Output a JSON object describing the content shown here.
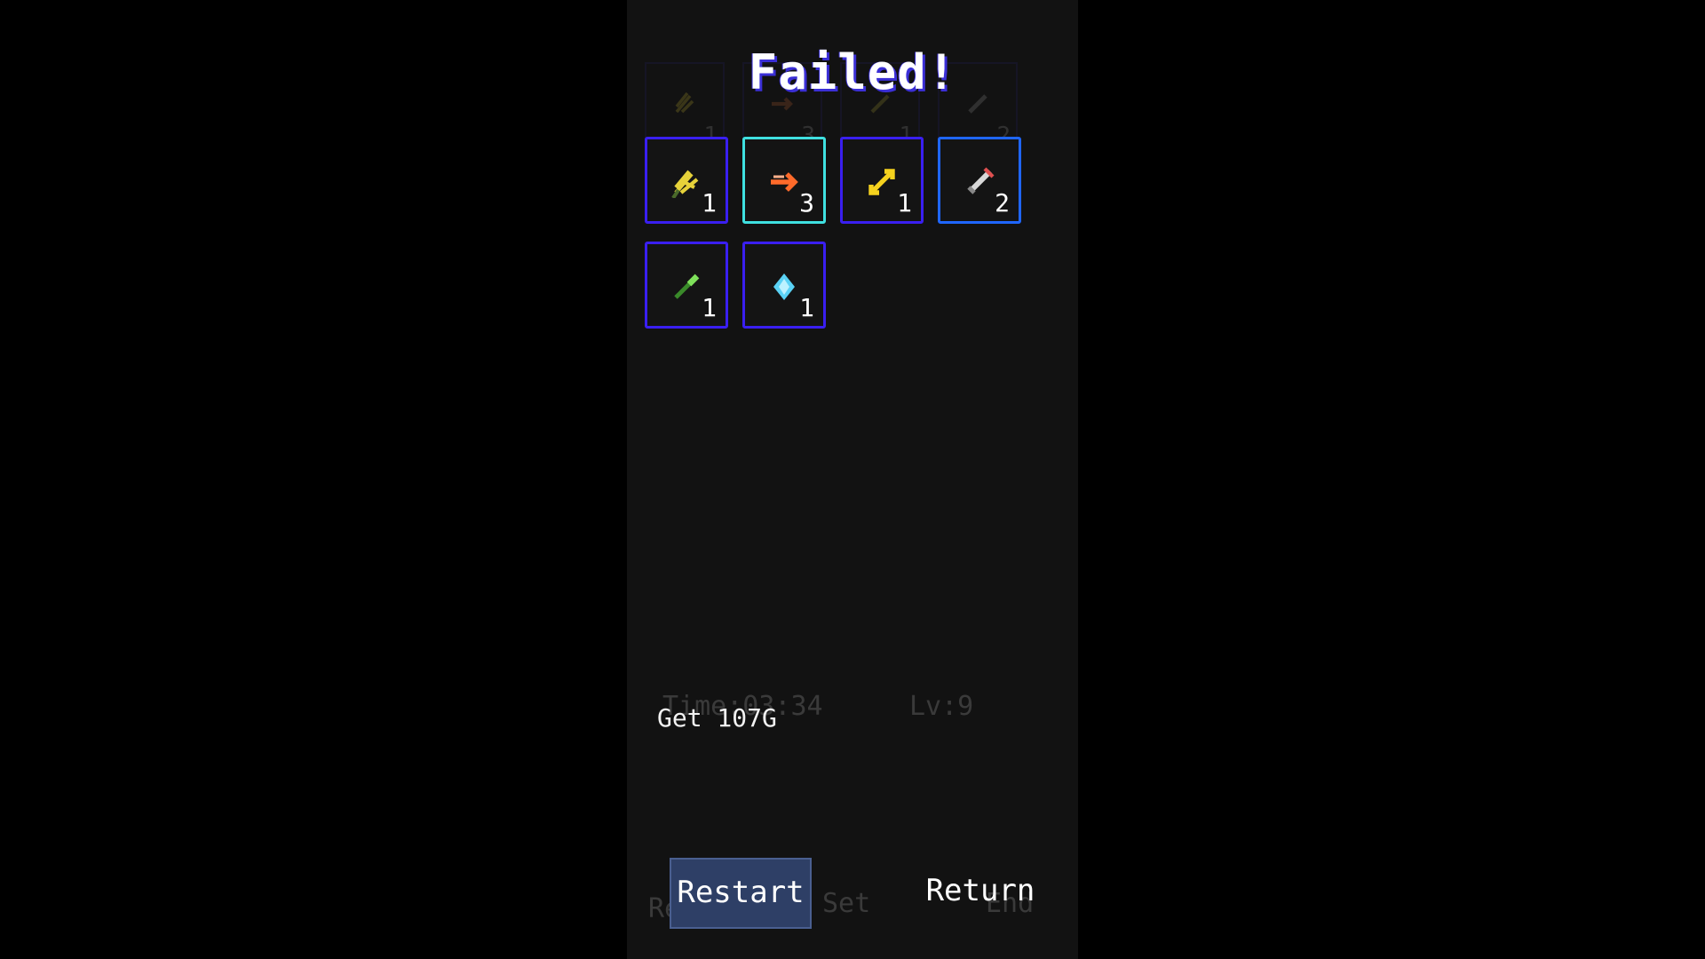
{
  "screen": {
    "title": "Failed!",
    "reward_text": "Get 107G"
  },
  "background_hud": {
    "time_text": "Time:03:34",
    "level_text": "Lv:9",
    "bottom_labels": [
      "Return",
      "Set",
      "End"
    ],
    "ghost_counts": [
      "1",
      "3",
      "1",
      "2"
    ]
  },
  "items": [
    {
      "name": "yellow-claw-icon",
      "count": "1",
      "border": "purple",
      "color": "#e6d23a"
    },
    {
      "name": "fire-arrow-icon",
      "count": "3",
      "border": "cyan",
      "color": "#ff6a2a"
    },
    {
      "name": "gold-double-arrow-icon",
      "count": "1",
      "border": "purple",
      "color": "#f5d21e"
    },
    {
      "name": "steel-sword-icon",
      "count": "2",
      "border": "blue",
      "color": "#cfcfcf"
    },
    {
      "name": "green-wand-icon",
      "count": "1",
      "border": "purple",
      "color": "#57c93a"
    },
    {
      "name": "blue-crystal-icon",
      "count": "1",
      "border": "purple",
      "color": "#5ad2f5"
    }
  ],
  "buttons": {
    "restart_label": "Restart",
    "return_label": "Return"
  }
}
